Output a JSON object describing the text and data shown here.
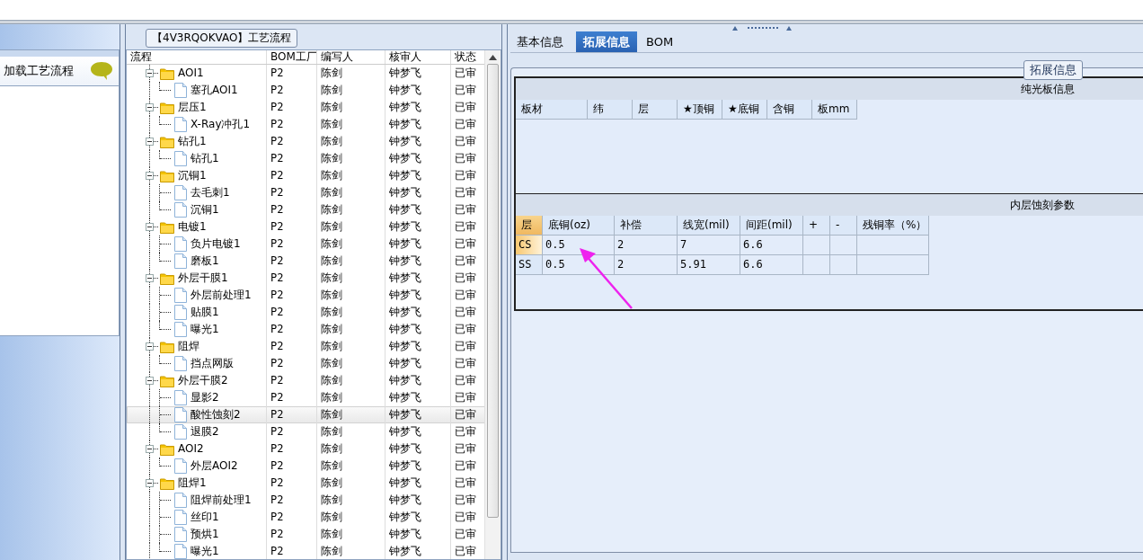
{
  "left_panel": {
    "title": "加载工艺流程"
  },
  "process_panel": {
    "legend": "【4V3RQOKVAO】工艺流程",
    "columns": [
      "流程",
      "BOM工厂",
      "编写人",
      "核审人",
      "状态"
    ],
    "rows": [
      {
        "name": "AOI1",
        "bom": "P2",
        "writer": "陈剑",
        "reviewer": "钟梦飞",
        "status": "已审",
        "expanded": true,
        "selected": false,
        "children": [
          {
            "name": "塞孔AOI1",
            "bom": "P2",
            "writer": "陈剑",
            "reviewer": "钟梦飞",
            "status": "已审",
            "selected": false
          }
        ]
      },
      {
        "name": "层压1",
        "bom": "P2",
        "writer": "陈剑",
        "reviewer": "钟梦飞",
        "status": "已审",
        "expanded": true,
        "selected": false,
        "children": [
          {
            "name": "X-Ray冲孔1",
            "bom": "P2",
            "writer": "陈剑",
            "reviewer": "钟梦飞",
            "status": "已审",
            "selected": false
          }
        ]
      },
      {
        "name": "钻孔1",
        "bom": "P2",
        "writer": "陈剑",
        "reviewer": "钟梦飞",
        "status": "已审",
        "expanded": true,
        "selected": false,
        "children": [
          {
            "name": "钻孔1",
            "bom": "P2",
            "writer": "陈剑",
            "reviewer": "钟梦飞",
            "status": "已审",
            "selected": false
          }
        ]
      },
      {
        "name": "沉铜1",
        "bom": "P2",
        "writer": "陈剑",
        "reviewer": "钟梦飞",
        "status": "已审",
        "expanded": true,
        "selected": false,
        "children": [
          {
            "name": "去毛刺1",
            "bom": "P2",
            "writer": "陈剑",
            "reviewer": "钟梦飞",
            "status": "已审",
            "selected": false
          },
          {
            "name": "沉铜1",
            "bom": "P2",
            "writer": "陈剑",
            "reviewer": "钟梦飞",
            "status": "已审",
            "selected": false
          }
        ]
      },
      {
        "name": "电镀1",
        "bom": "P2",
        "writer": "陈剑",
        "reviewer": "钟梦飞",
        "status": "已审",
        "expanded": true,
        "selected": false,
        "children": [
          {
            "name": "负片电镀1",
            "bom": "P2",
            "writer": "陈剑",
            "reviewer": "钟梦飞",
            "status": "已审",
            "selected": false
          },
          {
            "name": "磨板1",
            "bom": "P2",
            "writer": "陈剑",
            "reviewer": "钟梦飞",
            "status": "已审",
            "selected": false
          }
        ]
      },
      {
        "name": "外层干膜1",
        "bom": "P2",
        "writer": "陈剑",
        "reviewer": "钟梦飞",
        "status": "已审",
        "expanded": true,
        "selected": false,
        "children": [
          {
            "name": "外层前处理1",
            "bom": "P2",
            "writer": "陈剑",
            "reviewer": "钟梦飞",
            "status": "已审",
            "selected": false
          },
          {
            "name": "贴膜1",
            "bom": "P2",
            "writer": "陈剑",
            "reviewer": "钟梦飞",
            "status": "已审",
            "selected": false
          },
          {
            "name": "曝光1",
            "bom": "P2",
            "writer": "陈剑",
            "reviewer": "钟梦飞",
            "status": "已审",
            "selected": false
          }
        ]
      },
      {
        "name": "阻焊",
        "bom": "P2",
        "writer": "陈剑",
        "reviewer": "钟梦飞",
        "status": "已审",
        "expanded": true,
        "selected": false,
        "children": [
          {
            "name": "挡点网版",
            "bom": "P2",
            "writer": "陈剑",
            "reviewer": "钟梦飞",
            "status": "已审",
            "selected": false
          }
        ]
      },
      {
        "name": "外层干膜2",
        "bom": "P2",
        "writer": "陈剑",
        "reviewer": "钟梦飞",
        "status": "已审",
        "expanded": true,
        "selected": false,
        "children": [
          {
            "name": "显影2",
            "bom": "P2",
            "writer": "陈剑",
            "reviewer": "钟梦飞",
            "status": "已审",
            "selected": false
          },
          {
            "name": "酸性蚀刻2",
            "bom": "P2",
            "writer": "陈剑",
            "reviewer": "钟梦飞",
            "status": "已审",
            "selected": true
          },
          {
            "name": "退膜2",
            "bom": "P2",
            "writer": "陈剑",
            "reviewer": "钟梦飞",
            "status": "已审",
            "selected": false
          }
        ]
      },
      {
        "name": "AOI2",
        "bom": "P2",
        "writer": "陈剑",
        "reviewer": "钟梦飞",
        "status": "已审",
        "expanded": true,
        "selected": false,
        "children": [
          {
            "name": "外层AOI2",
            "bom": "P2",
            "writer": "陈剑",
            "reviewer": "钟梦飞",
            "status": "已审",
            "selected": false
          }
        ]
      },
      {
        "name": "阻焊1",
        "bom": "P2",
        "writer": "陈剑",
        "reviewer": "钟梦飞",
        "status": "已审",
        "expanded": true,
        "selected": false,
        "children": [
          {
            "name": "阻焊前处理1",
            "bom": "P2",
            "writer": "陈剑",
            "reviewer": "钟梦飞",
            "status": "已审",
            "selected": false
          },
          {
            "name": "丝印1",
            "bom": "P2",
            "writer": "陈剑",
            "reviewer": "钟梦飞",
            "status": "已审",
            "selected": false
          },
          {
            "name": "预烘1",
            "bom": "P2",
            "writer": "陈剑",
            "reviewer": "钟梦飞",
            "status": "已审",
            "selected": false
          },
          {
            "name": "曝光1",
            "bom": "P2",
            "writer": "陈剑",
            "reviewer": "钟梦飞",
            "status": "已审",
            "selected": false
          }
        ]
      }
    ]
  },
  "detail_panel": {
    "tabs": [
      {
        "label": "基本信息",
        "selected": false
      },
      {
        "label": "拓展信息",
        "selected": true
      },
      {
        "label": "BOM",
        "selected": false
      }
    ],
    "legend": "拓展信息",
    "sections": [
      {
        "title": "纯光板信息",
        "columns": [
          "板材",
          "纬",
          "层",
          "★顶铜",
          "★底铜",
          "含铜",
          "板mm"
        ]
      },
      {
        "title": "内层蚀刻参数",
        "columns": [
          "层",
          "底铜(oz)",
          "补偿",
          "线宽(mil)",
          "间距(mil)",
          "+",
          "-",
          "残铜率（%）"
        ],
        "rows": [
          {
            "selected": true,
            "cells": [
              "CS",
              "0.5",
              "2",
              "7",
              "6.6",
              "",
              "",
              ""
            ]
          },
          {
            "selected": false,
            "cells": [
              "SS",
              "0.5",
              "2",
              "5.91",
              "6.6",
              "",
              "",
              ""
            ]
          }
        ]
      }
    ]
  }
}
